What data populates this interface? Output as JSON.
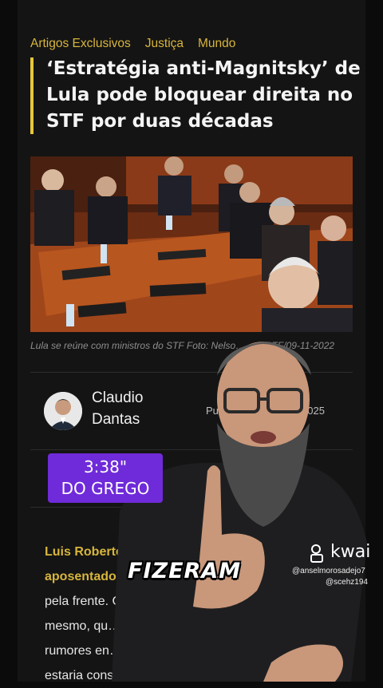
{
  "article": {
    "categories": [
      "Artigos Exclusivos",
      "Justiça",
      "Mundo"
    ],
    "title": "‘Estratégia anti-Magnitsky’ de Lula pode bloquear direita no STF por duas décadas",
    "photo_caption": "Lula se reúne com ministros do STF Foto: Nelso… …o/STF/09-11-2022",
    "author": {
      "name": "Claudio Dantas",
      "published_prefix": "Pu",
      "published_year": "2025"
    },
    "comments_fragment": "ios",
    "body": {
      "lead_gold": "Luis Roberto B…",
      "line2_gold": "aposentadori…",
      "line3": "pela frente. C…",
      "line4": "mesmo, qu…",
      "line5": "rumores en…",
      "line6": "estaria cons… …ndo"
    }
  },
  "overlay": {
    "timer": "3:38\"",
    "timer_label": "DO GREGO",
    "subtitle": "FIZERAM",
    "watermark_logo": "kwai",
    "watermark_handle1": "@anselmorosadejo7",
    "watermark_handle2": "@scehz194"
  },
  "colors": {
    "accent_gold": "#d7b53c",
    "timer_purple": "#6f2bd9",
    "background": "#141414"
  }
}
